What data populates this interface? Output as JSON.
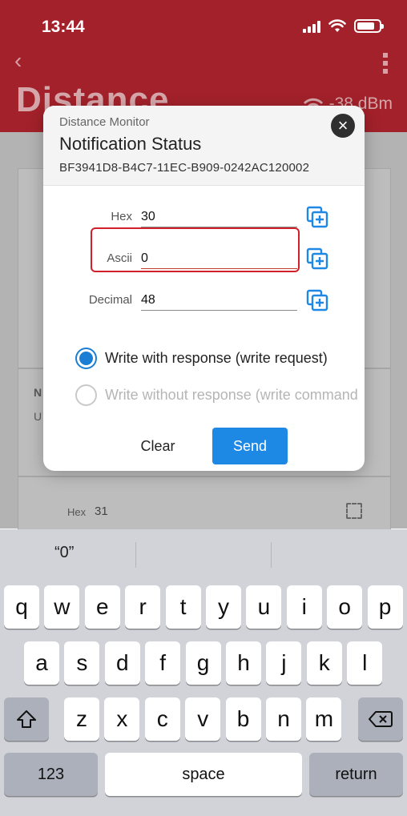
{
  "status_bar": {
    "time": "13:44"
  },
  "app": {
    "title": "Distance",
    "rssi": "-38 dBm",
    "bg_hex_label": "Hex",
    "bg_hex_value": "31",
    "bg_letter_n": "N",
    "bg_letter_u": "U"
  },
  "dialog": {
    "subtitle": "Distance Monitor",
    "title": "Notification Status",
    "uuid": "BF3941D8-B4C7-11EC-B909-0242AC120002",
    "fields": {
      "hex": {
        "label": "Hex",
        "value": "30"
      },
      "ascii": {
        "label": "Ascii",
        "value": "0"
      },
      "decimal": {
        "label": "Decimal",
        "value": "48"
      }
    },
    "write_options": [
      {
        "label": "Write with response (write request)",
        "checked": true
      },
      {
        "label": "Write without response (write command",
        "checked": false
      }
    ],
    "clear_label": "Clear",
    "send_label": "Send"
  },
  "keyboard": {
    "suggestion": "“0”",
    "row1": [
      "q",
      "w",
      "e",
      "r",
      "t",
      "y",
      "u",
      "i",
      "o",
      "p"
    ],
    "row2": [
      "a",
      "s",
      "d",
      "f",
      "g",
      "h",
      "j",
      "k",
      "l"
    ],
    "row3": [
      "z",
      "x",
      "c",
      "v",
      "b",
      "n",
      "m"
    ],
    "numbers_label": "123",
    "space_label": "space",
    "return_label": "return"
  },
  "colors": {
    "header": "#a3212a",
    "accent": "#1e88e5",
    "highlight": "#d11f2b"
  }
}
